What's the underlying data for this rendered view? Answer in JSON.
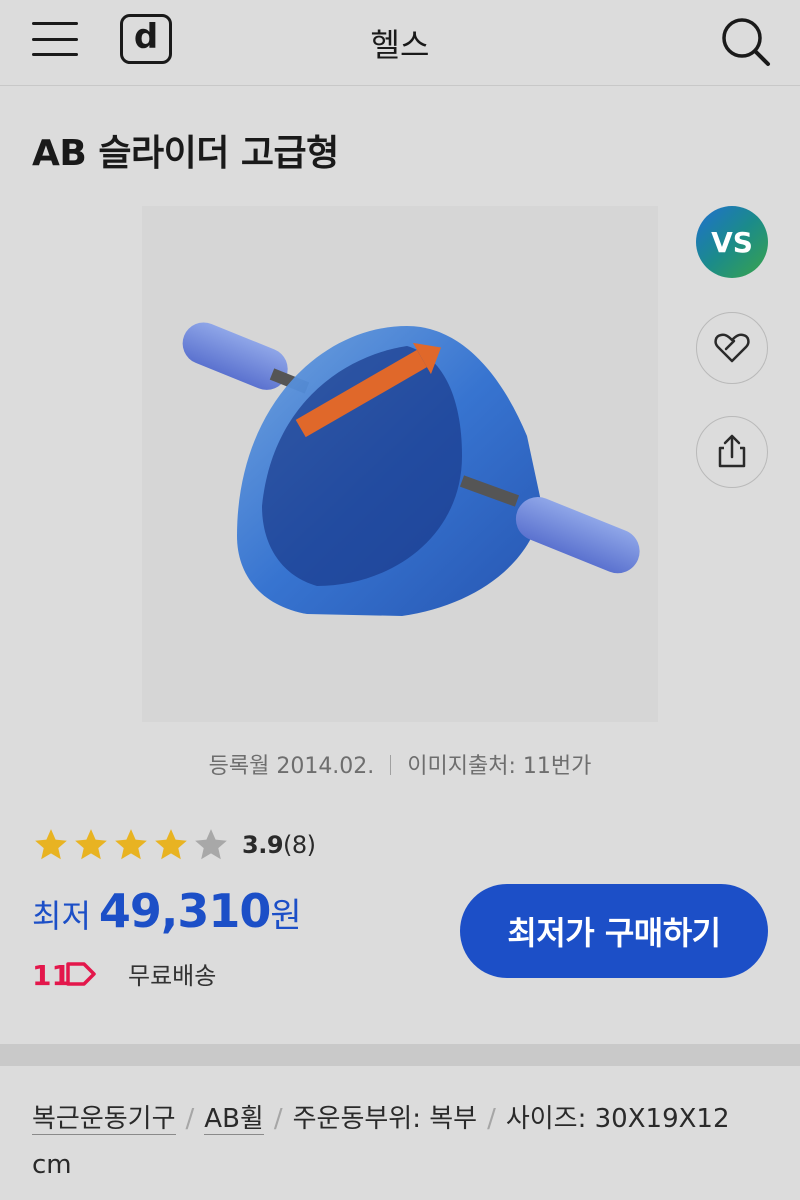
{
  "header": {
    "logo_text": "d",
    "title": "헬스"
  },
  "product": {
    "title": "AB 슬라이더 고급형",
    "image_alt": "AB 슬라이더 고급형 product image"
  },
  "side_actions": {
    "vs_label": "VS"
  },
  "meta": {
    "registered": "등록월 2014.02.",
    "image_source": "이미지출처: 11번가"
  },
  "rating": {
    "score": "3.9",
    "count": "(8)",
    "stars_filled": 4,
    "stars_total": 5
  },
  "price": {
    "label": "최저",
    "value": "49,310",
    "unit": "원"
  },
  "shipping": {
    "shop_logo_text": "11",
    "text": "무료배송"
  },
  "buy_button": {
    "label": "최저가 구매하기"
  },
  "tags": [
    {
      "label": "복근운동기구"
    },
    {
      "label": "AB휠"
    },
    {
      "label": "주운동부위: 복부"
    },
    {
      "label": "사이즈: 30X19X12 cm"
    }
  ],
  "colors": {
    "accent": "#1c4fc7",
    "star": "#e8b322",
    "star_empty": "#a8a8a8",
    "shop_logo": "#e3174b"
  }
}
